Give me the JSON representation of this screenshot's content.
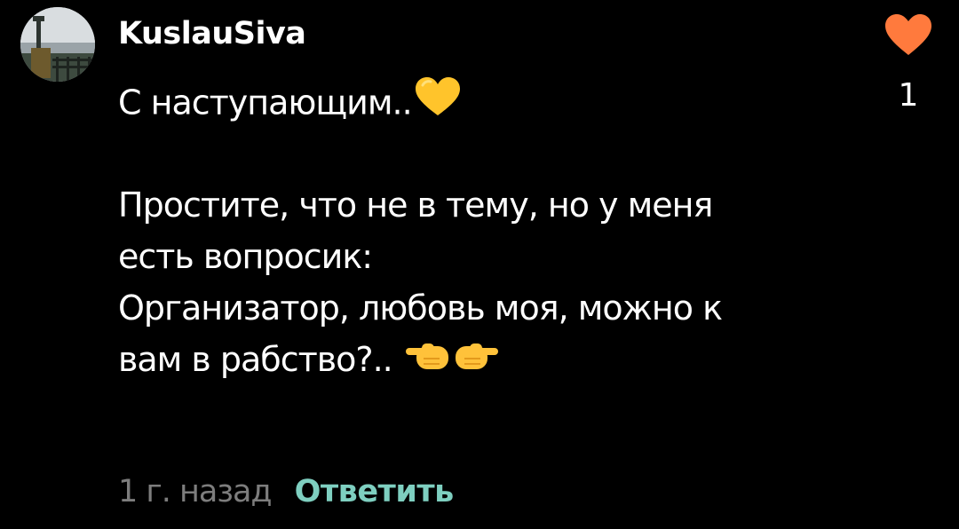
{
  "comment": {
    "author": "KuslauSiva",
    "lines": [
      "С наступающим..",
      "",
      "Простите, что не в тему, но у меня",
      "есть вопросик:",
      "Организатор, любовь моя, можно к",
      "вам в рабство?.."
    ],
    "emoji_after_line_1": "yellow-heart",
    "emoji_after_line_6": "pointing-fingers",
    "time": "1 г. назад",
    "reply_label": "Ответить",
    "like_count": "1",
    "like_icon": "heart-icon",
    "like_color": "#ff7a3d",
    "reply_color": "#7ecfc0"
  }
}
